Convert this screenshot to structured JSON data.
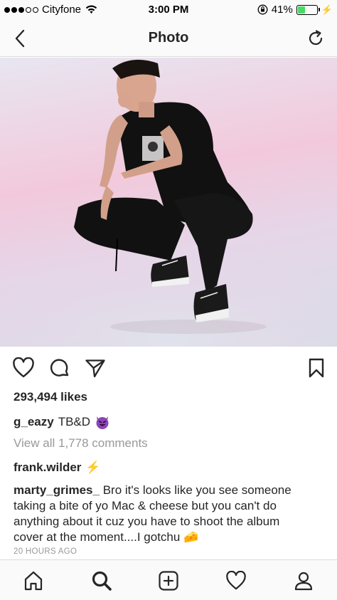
{
  "status_bar": {
    "carrier": "Cityfone",
    "time": "3:00 PM",
    "battery": "41%",
    "battery_level": 0.41,
    "battery_color": "#4cd964"
  },
  "nav": {
    "title": "Photo",
    "back_icon": "chevron-left-icon",
    "refresh_icon": "refresh-icon"
  },
  "photo": {
    "alt": "Man in black outfit crouching against pink backdrop"
  },
  "actions": {
    "icons": [
      "heart-icon",
      "comment-icon",
      "share-icon",
      "bookmark-icon"
    ]
  },
  "post": {
    "likes": "293,494 likes",
    "author": "g_eazy",
    "caption": "TB&D",
    "view_comments": "View all 1,778 comments",
    "comments": [
      {
        "user": "frank.wilder",
        "text": "⚡"
      },
      {
        "user": "marty_grimes_",
        "text": "Bro it's looks like you see someone taking a bite of yo Mac & cheese but you can't do anything about it cuz you have to shoot the album cover at the moment....I gotchu 🧀"
      }
    ],
    "timestamp": "20 HOURS AGO"
  },
  "tab_bar": {
    "icons": [
      "home-icon",
      "search-icon",
      "add-post-icon",
      "activity-heart-icon",
      "profile-icon"
    ]
  }
}
